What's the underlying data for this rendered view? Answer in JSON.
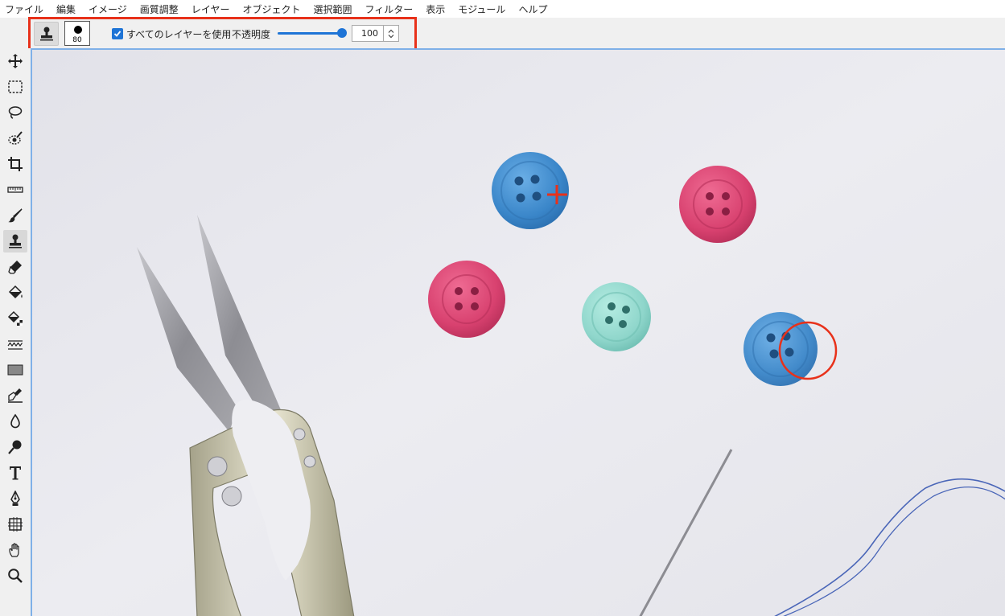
{
  "menu": [
    "ファイル",
    "編集",
    "イメージ",
    "画質調整",
    "レイヤー",
    "オブジェクト",
    "選択範囲",
    "フィルター",
    "表示",
    "モジュール",
    "ヘルプ"
  ],
  "options": {
    "brush_size": "80",
    "use_all_layers_label": "すべてのレイヤーを使用",
    "use_all_layers_checked": true,
    "opacity_label": "不透明度",
    "opacity_value": "100",
    "opacity_percent": 100
  },
  "tools": [
    "move-icon",
    "marquee-icon",
    "lasso-icon",
    "quick-select-icon",
    "crop-icon",
    "ruler-icon",
    "brush-icon",
    "clone-stamp-icon",
    "eraser-icon",
    "paint-bucket-icon",
    "gradient-fill-icon",
    "wave-icon",
    "rectangle-icon",
    "pen-edit-icon",
    "blur-drop-icon",
    "dodge-icon",
    "text-icon",
    "pen-tool-icon",
    "transform-icon",
    "hand-icon",
    "zoom-icon"
  ],
  "active_tool": "clone-stamp-icon",
  "colors": {
    "accent": "#1e74d6",
    "highlight_frame": "#e8311a",
    "cursor_marker": "#e8311a",
    "button_blue": "#3a86c9",
    "button_pink": "#d8416f",
    "button_teal": "#8fd6cb"
  }
}
